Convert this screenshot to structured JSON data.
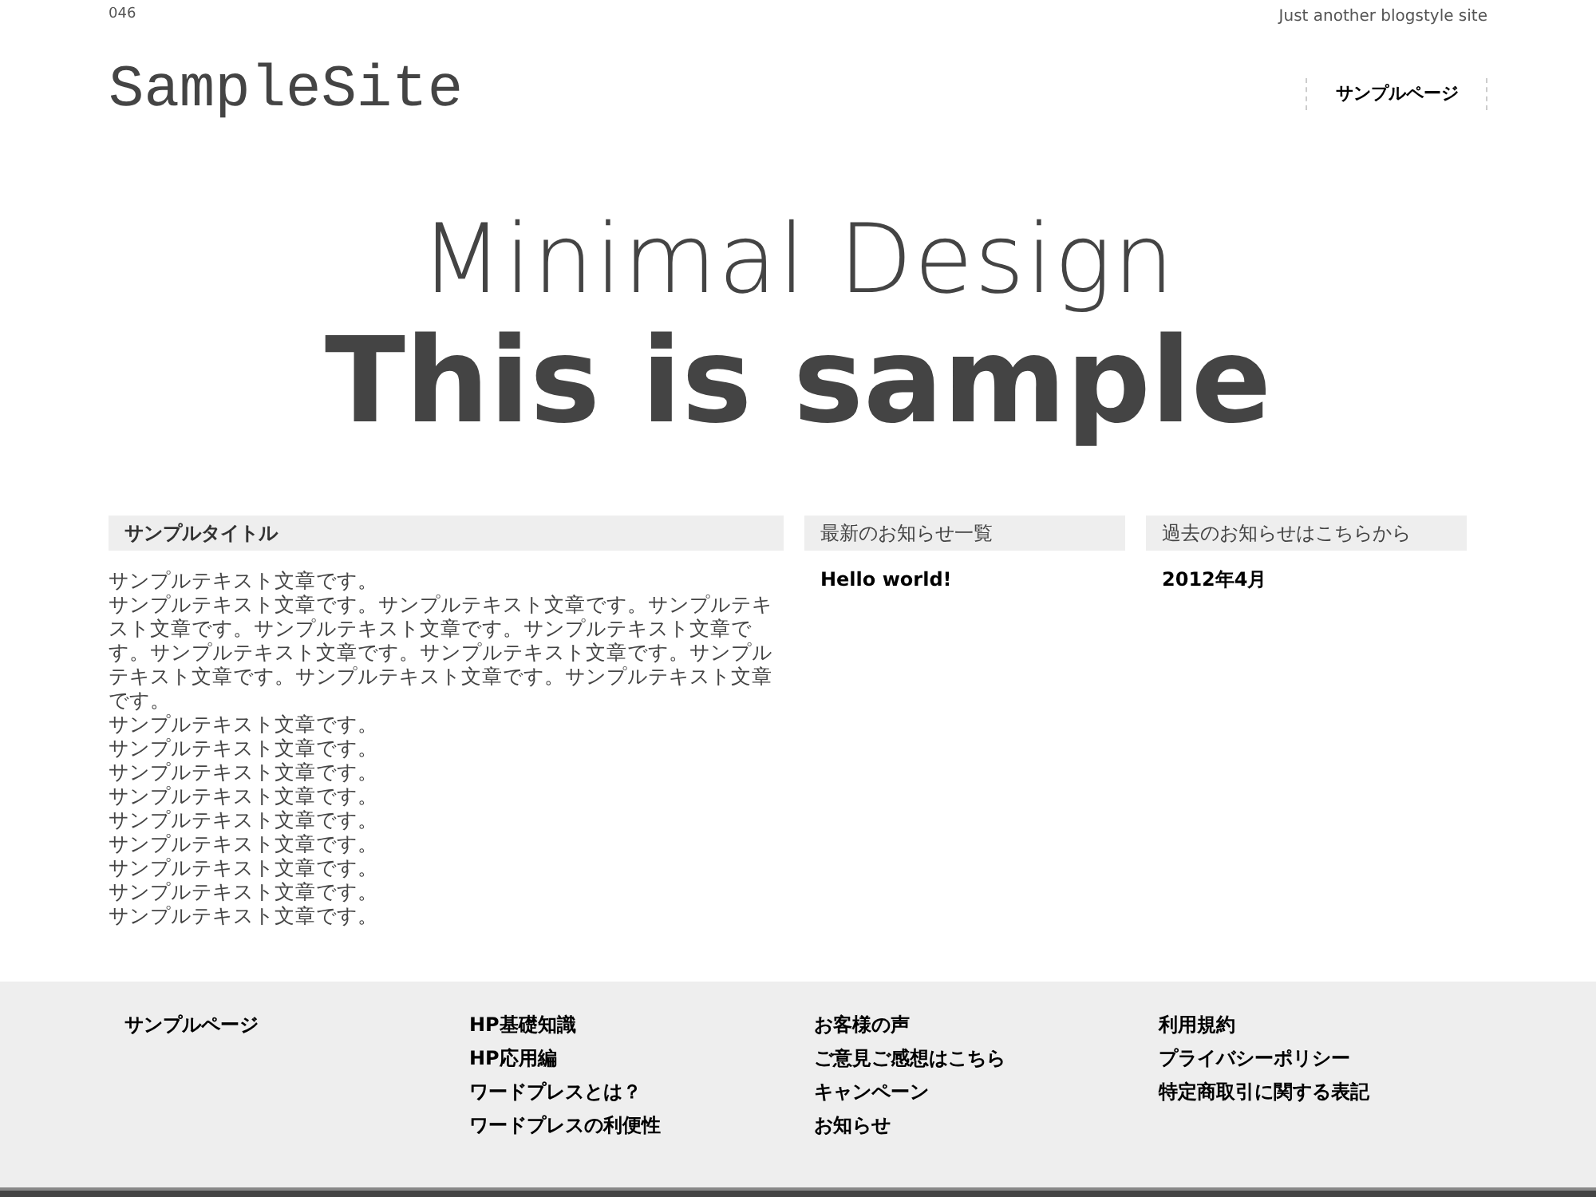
{
  "top_bar": {
    "site_id": "046",
    "tagline": "Just another blogstyle site"
  },
  "header": {
    "logo": "SampleSite",
    "nav": [
      "サンプルページ"
    ]
  },
  "hero": {
    "subtitle": "Minimal Design",
    "title": "This is sample"
  },
  "main_column": {
    "title": "サンプルタイトル",
    "paragraphs": [
      "サンプルテキスト文章です。",
      "サンプルテキスト文章です。サンプルテキスト文章です。サンプルテキスト文章です。サンプルテキスト文章です。サンプルテキスト文章です。サンプルテキスト文章です。サンプルテキスト文章です。サンプルテキスト文章です。サンプルテキスト文章です。サンプルテキスト文章です。",
      "サンプルテキスト文章です。",
      "サンプルテキスト文章です。",
      "サンプルテキスト文章です。",
      "サンプルテキスト文章です。",
      "サンプルテキスト文章です。",
      "サンプルテキスト文章です。",
      "サンプルテキスト文章です。",
      "サンプルテキスト文章です。",
      "サンプルテキスト文章です。"
    ]
  },
  "widgets": [
    {
      "title": "最新のお知らせ一覧",
      "items": [
        "Hello world!"
      ]
    },
    {
      "title": "過去のお知らせはこちらから",
      "items": [
        "2012年4月"
      ]
    }
  ],
  "footer": {
    "columns": [
      [
        "サンプルページ"
      ],
      [
        "HP基礎知識",
        "HP応用編",
        "ワードプレスとは？",
        "ワードプレスの利便性"
      ],
      [
        "お客様の声",
        "ご意見ご感想はこちら",
        "キャンペーン",
        "お知らせ"
      ],
      [
        "利用規約",
        "プライバシーポリシー",
        "特定商取引に関する表記"
      ]
    ]
  }
}
